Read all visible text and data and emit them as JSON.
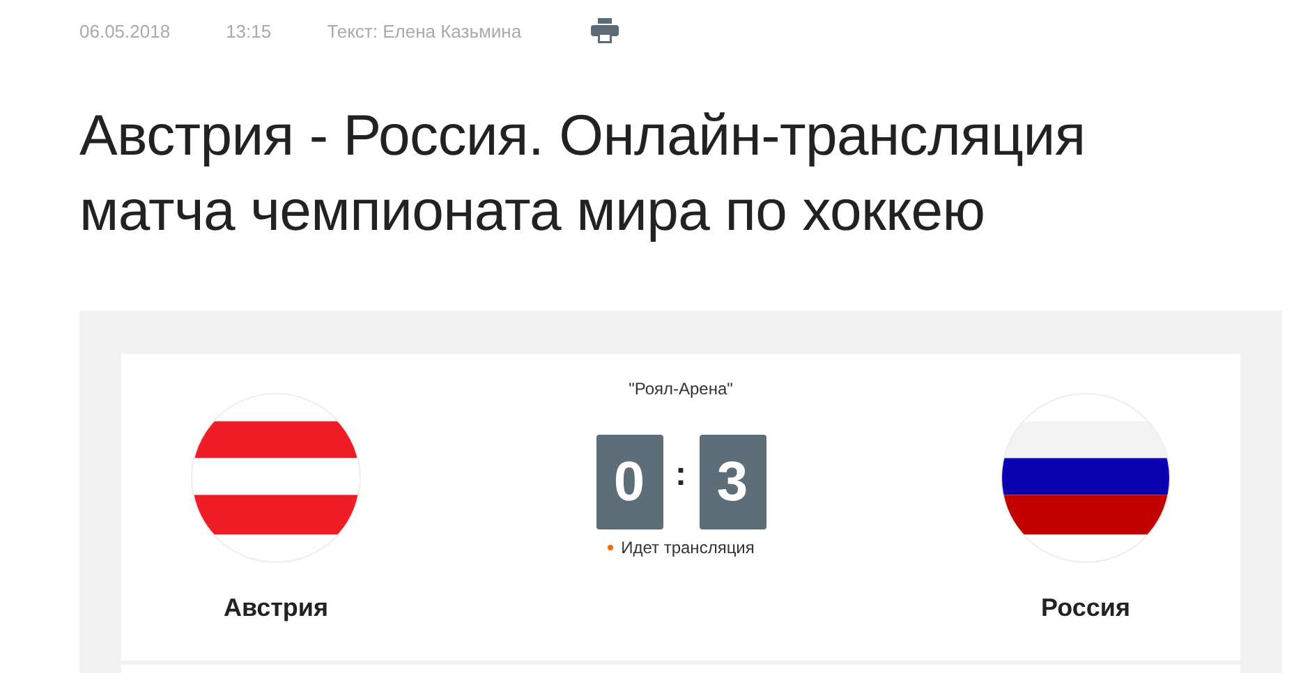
{
  "meta": {
    "date": "06.05.2018",
    "time": "13:15",
    "author": "Текст: Елена Казьмина"
  },
  "title": "Австрия - Россия. Онлайн-трансляция матча чемпионата мира по хоккею",
  "match": {
    "venue": "\"Роял-Арена\"",
    "score": [
      "0",
      "3"
    ],
    "separator": ":",
    "status": "Идет трансляция",
    "live": true,
    "teams": [
      {
        "name": "Австрия",
        "stripes": [
          {
            "color": "#ffffff"
          },
          {
            "color": "#ef1d25"
          },
          {
            "color": "#ffffff"
          },
          {
            "color": "#ef1d25"
          },
          {
            "color": "#ffffff"
          }
        ]
      },
      {
        "name": "Россия",
        "stripes": [
          {
            "color": "#ffffff"
          },
          {
            "color": "#f2f3f2"
          },
          {
            "color": "#0a00b0"
          },
          {
            "color": "#c20000"
          },
          {
            "color": "#ffffff"
          }
        ]
      }
    ]
  }
}
